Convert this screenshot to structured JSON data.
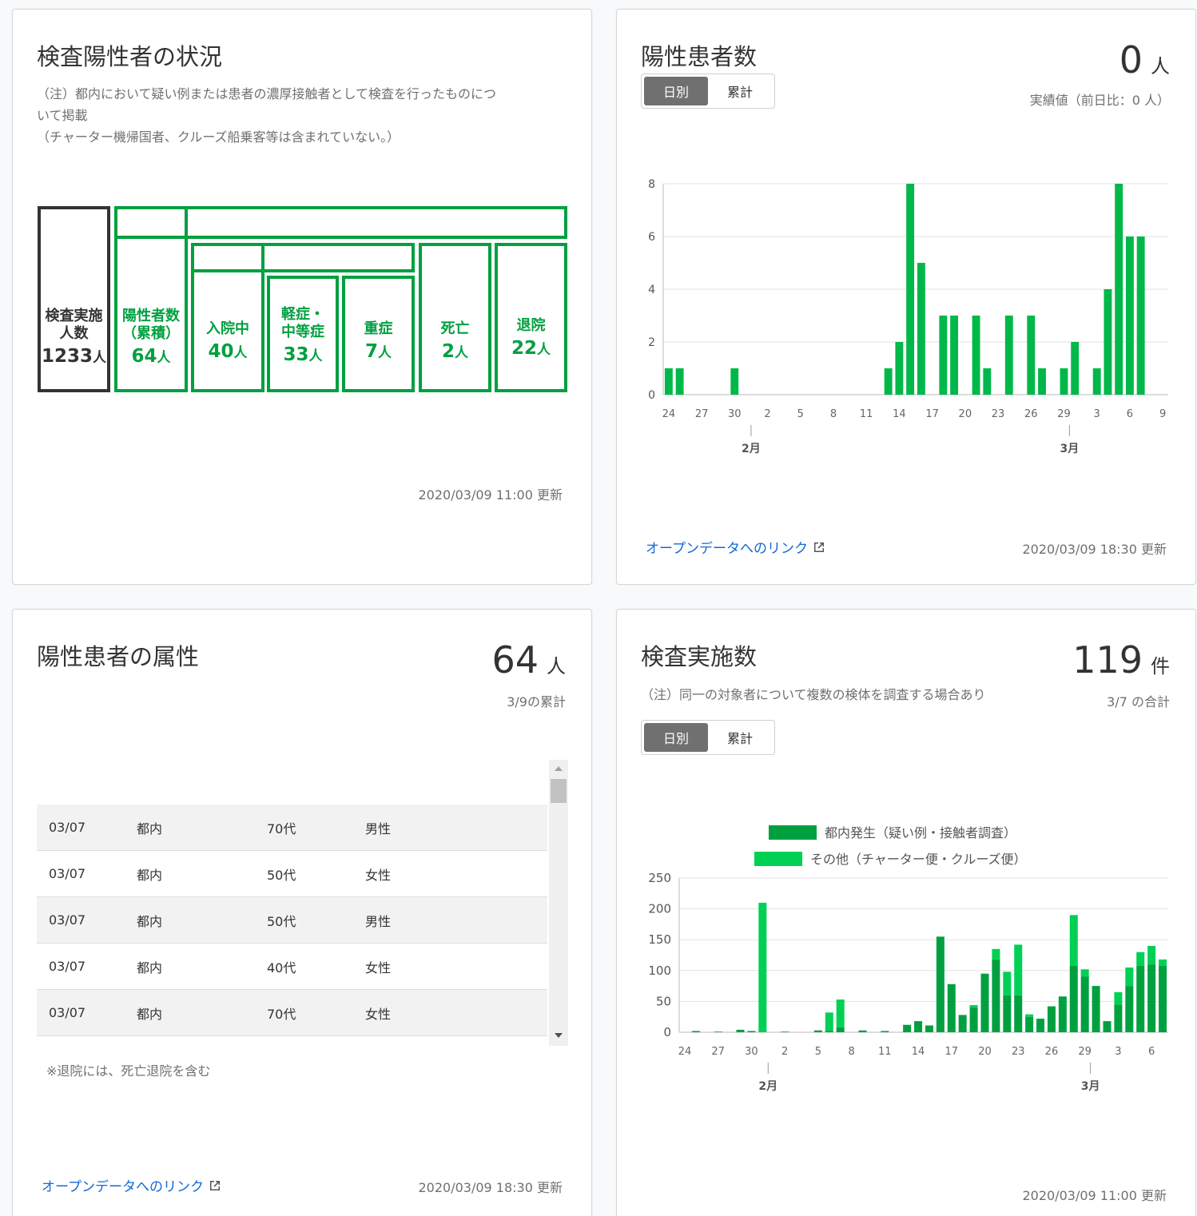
{
  "status": {
    "title": "検査陽性者の状況",
    "note_line1": "（注）都内において疑い例または患者の濃厚接触者として検査を行ったものにつ",
    "note_line2": "いて掲載",
    "note_line3": "（チャーター機帰国者、クルーズ船乗客等は含まれていない。）",
    "tested_label1": "検査実施",
    "tested_label2": "人数",
    "tested_value": "1233",
    "positive_label1": "陽性者数",
    "positive_label2": "（累積）",
    "positive_value": "64",
    "hospital_label": "入院中",
    "hospital_value": "40",
    "mild_label1": "軽症・",
    "mild_label2": "中等症",
    "mild_value": "33",
    "severe_label": "重症",
    "severe_value": "7",
    "death_label": "死亡",
    "death_value": "2",
    "discharged_label": "退院",
    "discharged_value": "22",
    "unit": "人",
    "updated": "2020/03/09 11:00 更新"
  },
  "patients": {
    "title": "陽性患者数",
    "value": "0",
    "unit": "人",
    "subnote": "実績値（前日比：0 人）",
    "toggle_daily": "日別",
    "toggle_cumulative": "累計",
    "link": "オープンデータへのリンク",
    "updated": "2020/03/09 18:30 更新"
  },
  "attributes": {
    "title": "陽性患者の属性",
    "value": "64",
    "unit": "人",
    "subnote": "3/9の累計",
    "rows": [
      {
        "date": "03/07",
        "area": "都内",
        "age": "70代",
        "sex": "男性"
      },
      {
        "date": "03/07",
        "area": "都内",
        "age": "50代",
        "sex": "女性"
      },
      {
        "date": "03/07",
        "area": "都内",
        "age": "50代",
        "sex": "男性"
      },
      {
        "date": "03/07",
        "area": "都内",
        "age": "40代",
        "sex": "女性"
      },
      {
        "date": "03/07",
        "area": "都内",
        "age": "70代",
        "sex": "女性"
      }
    ],
    "footnote": "※退院には、死亡退院を含む",
    "link": "オープンデータへのリンク",
    "updated": "2020/03/09 18:30 更新"
  },
  "tests": {
    "title": "検査実施数",
    "value": "119",
    "unit": "件",
    "note": "（注）同一の対象者について複数の検体を調査する場合あり",
    "subnote": "3/7 の合計",
    "toggle_daily": "日別",
    "toggle_cumulative": "累計",
    "updated": "2020/03/09 11:00 更新"
  },
  "colors": {
    "bar": "#00b849",
    "domestic": "#00a040",
    "other": "#00d154",
    "green": "#00a040"
  },
  "chart_data": [
    {
      "type": "bar",
      "x": [
        "1/24",
        "1/25",
        "1/26",
        "1/27",
        "1/28",
        "1/29",
        "1/30",
        "1/31",
        "2/1",
        "2/2",
        "2/3",
        "2/4",
        "2/5",
        "2/6",
        "2/7",
        "2/8",
        "2/9",
        "2/10",
        "2/11",
        "2/12",
        "2/13",
        "2/14",
        "2/15",
        "2/16",
        "2/17",
        "2/18",
        "2/19",
        "2/20",
        "2/21",
        "2/22",
        "2/23",
        "2/24",
        "2/25",
        "2/26",
        "2/27",
        "2/28",
        "2/29",
        "3/1",
        "3/2",
        "3/3",
        "3/4",
        "3/5",
        "3/6",
        "3/7",
        "3/8",
        "3/9"
      ],
      "values": [
        1,
        1,
        0,
        0,
        0,
        0,
        1,
        0,
        0,
        0,
        0,
        0,
        0,
        0,
        0,
        0,
        0,
        0,
        0,
        0,
        1,
        2,
        8,
        5,
        0,
        3,
        3,
        0,
        3,
        1,
        0,
        3,
        0,
        3,
        1,
        0,
        1,
        2,
        0,
        1,
        4,
        8,
        6,
        6,
        0,
        0
      ],
      "tick_labels": [
        "24",
        "27",
        "30",
        "2",
        "5",
        "8",
        "11",
        "14",
        "17",
        "20",
        "23",
        "26",
        "29",
        "3",
        "6",
        "9"
      ],
      "month_labels": [
        "2月",
        "3月"
      ],
      "yticks": [
        "0",
        "2",
        "4",
        "6",
        "8"
      ],
      "ylim": [
        0,
        8
      ]
    },
    {
      "type": "bar",
      "stacked": true,
      "x": [
        "1/24",
        "1/25",
        "1/26",
        "1/27",
        "1/28",
        "1/29",
        "1/30",
        "1/31",
        "2/1",
        "2/2",
        "2/3",
        "2/4",
        "2/5",
        "2/6",
        "2/7",
        "2/8",
        "2/9",
        "2/10",
        "2/11",
        "2/12",
        "2/13",
        "2/14",
        "2/15",
        "2/16",
        "2/17",
        "2/18",
        "2/19",
        "2/20",
        "2/21",
        "2/22",
        "2/23",
        "2/24",
        "2/25",
        "2/26",
        "2/27",
        "2/28",
        "2/29",
        "3/1",
        "3/2",
        "3/3",
        "3/4",
        "3/5",
        "3/6",
        "3/7"
      ],
      "series": [
        {
          "name": "都内発生（疑い例・接触者調査）",
          "values": [
            0,
            2,
            0,
            1,
            0,
            4,
            2,
            0,
            0,
            1,
            0,
            0,
            3,
            2,
            8,
            0,
            3,
            0,
            2,
            0,
            12,
            18,
            11,
            155,
            78,
            28,
            40,
            95,
            118,
            60,
            60,
            25,
            22,
            42,
            58,
            108,
            90,
            75,
            18,
            45,
            75,
            108,
            110,
            108
          ]
        },
        {
          "name": "その他（チャーター便・クルーズ便）",
          "values": [
            0,
            0,
            0,
            0,
            0,
            0,
            0,
            210,
            0,
            0,
            0,
            0,
            0,
            30,
            45,
            0,
            0,
            0,
            0,
            0,
            0,
            0,
            0,
            0,
            0,
            0,
            4,
            0,
            17,
            38,
            82,
            4,
            0,
            0,
            0,
            82,
            12,
            0,
            0,
            20,
            30,
            22,
            30,
            10
          ]
        }
      ],
      "tick_labels": [
        "24",
        "27",
        "30",
        "2",
        "5",
        "8",
        "11",
        "14",
        "17",
        "20",
        "23",
        "26",
        "29",
        "3",
        "6"
      ],
      "month_labels": [
        "2月",
        "3月"
      ],
      "yticks": [
        "0",
        "50",
        "100",
        "150",
        "200",
        "250"
      ],
      "ylim": [
        0,
        250
      ]
    }
  ]
}
